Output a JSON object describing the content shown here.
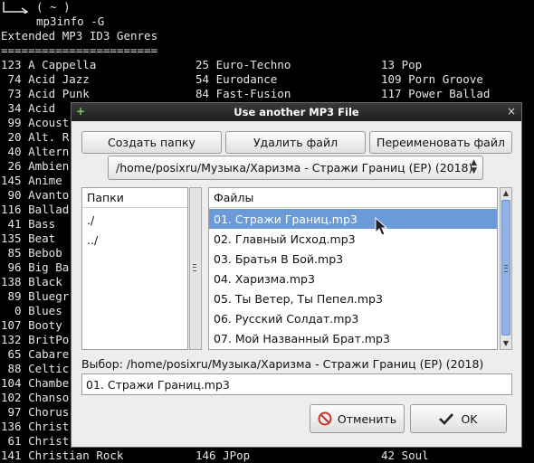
{
  "terminal": {
    "prompt_symbol": "( ~ )",
    "command": "mp3info -G",
    "heading": "Extended MP3 ID3 Genres",
    "rule": "=======================",
    "genre_rows": [
      {
        "a": "123 A Cappella",
        "b": "25 Euro-Techno",
        "c": "13 Pop"
      },
      {
        "a": " 74 Acid Jazz",
        "b": "54 Eurodance",
        "c": "109 Porn Groove"
      },
      {
        "a": " 73 Acid Punk",
        "b": "84 Fast-Fusion",
        "c": "117 Power Ballad"
      },
      {
        "a": " 34 Acid",
        "b": "",
        "c": ""
      },
      {
        "a": " 99 Acoust",
        "b": "",
        "c": ""
      },
      {
        "a": " 20 Alt. R",
        "b": "",
        "c": ""
      },
      {
        "a": " 40 Altern",
        "b": "",
        "c": ""
      },
      {
        "a": " 26 Ambien",
        "b": "",
        "c": ""
      },
      {
        "a": "145 Anime",
        "b": "",
        "c": ""
      },
      {
        "a": " 90 Avanto",
        "b": "",
        "c": ""
      },
      {
        "a": "116 Ballad",
        "b": "",
        "c": ""
      },
      {
        "a": " 41 Bass",
        "b": "",
        "c": ""
      },
      {
        "a": "135 Beat",
        "b": "",
        "c": ""
      },
      {
        "a": " 85 Bebob",
        "b": "",
        "c": ""
      },
      {
        "a": " 96 Big Ba",
        "b": "",
        "c": ""
      },
      {
        "a": "138 Black",
        "b": "",
        "c": ""
      },
      {
        "a": " 89 Bluegr",
        "b": "",
        "c": ""
      },
      {
        "a": "  0 Blues",
        "b": "",
        "c": ""
      },
      {
        "a": "107 Booty",
        "b": "",
        "c": ""
      },
      {
        "a": "132 BritPo",
        "b": "",
        "c": ""
      },
      {
        "a": " 65 Cabare",
        "b": "",
        "c": ""
      },
      {
        "a": " 88 Celtic",
        "b": "",
        "c": ""
      },
      {
        "a": "104 Chambe",
        "b": "",
        "c": ""
      },
      {
        "a": "102 Chanso",
        "b": "",
        "c": ""
      },
      {
        "a": " 97 Chorus",
        "b": "",
        "c": ""
      },
      {
        "a": "136 Christ",
        "b": "",
        "c": ""
      },
      {
        "a": " 61 Christ",
        "b": "",
        "c": ""
      },
      {
        "a": "141 Christian Rock",
        "b": "146 JPop",
        "c": "42 Soul"
      }
    ]
  },
  "dialog": {
    "title": "Use another MP3 File",
    "title_plus": "+",
    "close": "×",
    "buttons": {
      "create_folder": "Создать папку",
      "delete_file": "Удалить файл",
      "rename_file": "Переименовать файл",
      "cancel": "Отменить",
      "ok": "OK"
    },
    "path_combo": "/home/posixru/Музыка/Харизма - Стражи Границ (EP) (2018)",
    "folders": {
      "header": "Папки",
      "items": [
        "./",
        "../"
      ]
    },
    "files": {
      "header": "Файлы",
      "items": [
        "01. Стражи Границ.mp3",
        "02. Главный Исход.mp3",
        "03. Братья В Бой.mp3",
        "04. Харизма.mp3",
        "05. Ты Ветер, Ты Пепел.mp3",
        "06. Русский Солдат.mp3",
        "07. Мой Названный Брат.mp3"
      ],
      "selected_index": 0
    },
    "selection_label": "Выбор: /home/posixru/Музыка/Харизма - Стражи Границ (EP) (2018)",
    "selection_value": "01. Стражи Границ.mp3",
    "colors": {
      "selection": "#6b9ad9",
      "titlebar": "#2a2a2a",
      "cancel_icon": "#c0392b"
    }
  }
}
